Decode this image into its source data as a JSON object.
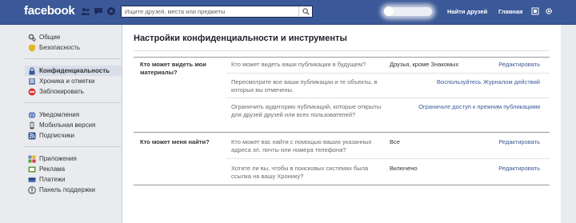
{
  "header": {
    "logo": "facebook",
    "search_placeholder": "Ищите друзей, места или предметы",
    "find_friends": "Найти друзей",
    "home": "Главная"
  },
  "sidebar": {
    "group1": [
      {
        "label": "Общие",
        "icon": "gear-icon"
      },
      {
        "label": "Безопасность",
        "icon": "shield-icon"
      }
    ],
    "group2": [
      {
        "label": "Конфиденциальность",
        "icon": "lock-icon"
      },
      {
        "label": "Хроника и отметки",
        "icon": "timeline-icon"
      },
      {
        "label": "Заблокировать",
        "icon": "block-icon"
      }
    ],
    "group3": [
      {
        "label": "Уведомления",
        "icon": "globe-icon"
      },
      {
        "label": "Мобильная версия",
        "icon": "mobile-icon"
      },
      {
        "label": "Подписчики",
        "icon": "rss-icon"
      }
    ],
    "group4": [
      {
        "label": "Приложения",
        "icon": "apps-icon"
      },
      {
        "label": "Реклама",
        "icon": "ads-icon"
      },
      {
        "label": "Платежи",
        "icon": "payments-icon"
      },
      {
        "label": "Панель поддержки",
        "icon": "support-icon"
      }
    ]
  },
  "main": {
    "title": "Настройки конфиденциальности и инструменты",
    "sections": [
      {
        "label": "Кто может видеть мои материалы?",
        "rows": [
          {
            "question": "Кто может видеть ваши публикации в будущем?",
            "value": "Друзья, кроме Знакомых",
            "action": "Редактировать"
          },
          {
            "question": "Пересмотрите все ваши публикации и те объекты, в которых вы отмечены.",
            "value": "",
            "action": "Воспользуйтесь Журналом действий"
          },
          {
            "question": "Ограничить аудиторию публикаций, которые открыты для друзей друзей или всех пользователей?",
            "value": "",
            "action": "Ограничьте доступ к прежним публикациям"
          }
        ]
      },
      {
        "label": "Кто может меня найти?",
        "rows": [
          {
            "question": "Кто может вас найти с помощью ваших указанных адреса эл. почты или номера телефона?",
            "value": "Все",
            "action": "Редактировать"
          },
          {
            "question": "Хотите ли вы, чтобы в поисковых системах была ссылка на вашу Хронику?",
            "value": "Включено",
            "action": "Редактировать"
          }
        ]
      }
    ]
  },
  "colors": {
    "brand": "#3b5998",
    "active_item": "#d8dfea",
    "link": "#3b5998"
  }
}
